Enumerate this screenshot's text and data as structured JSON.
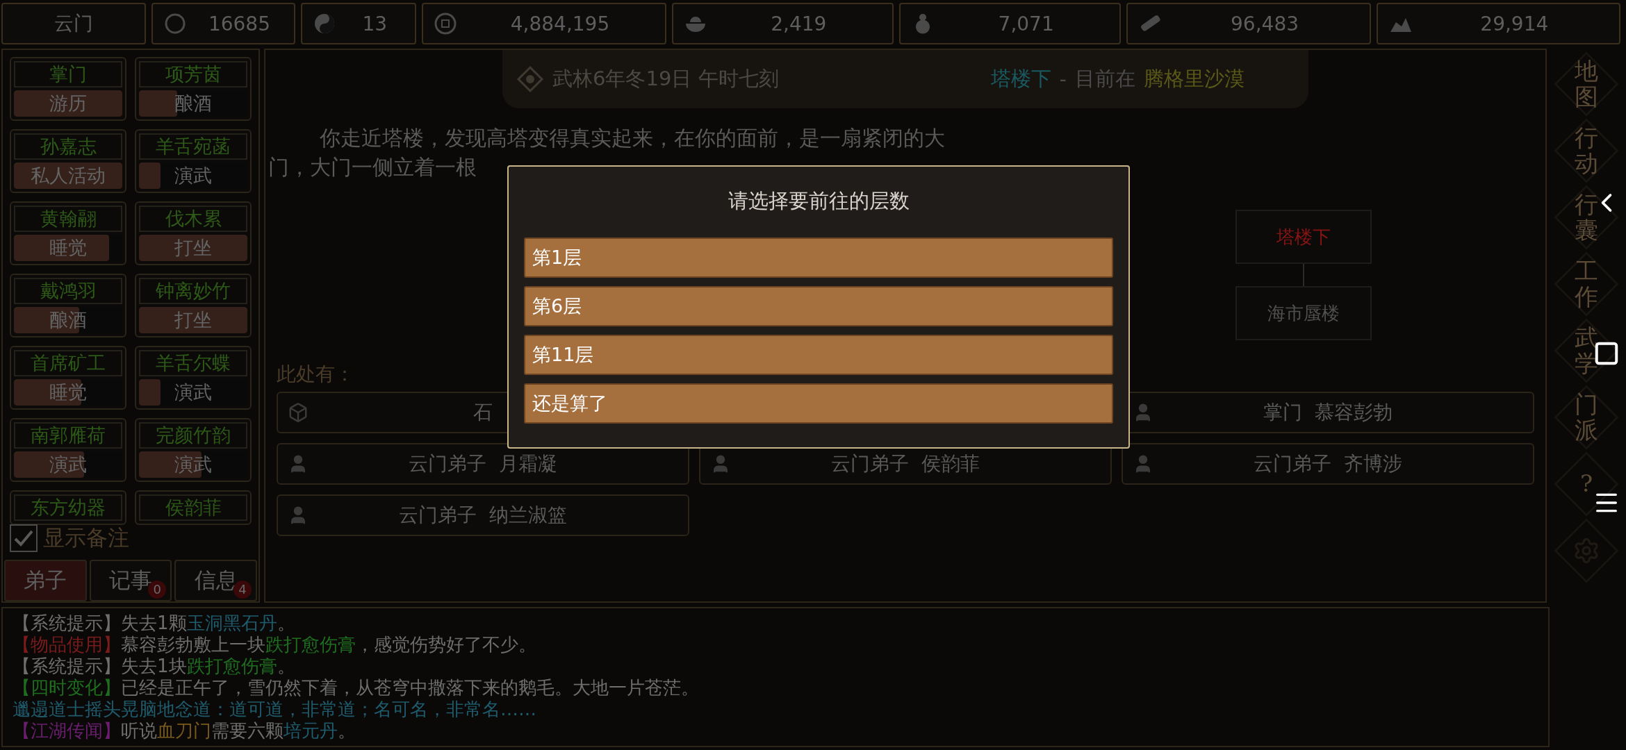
{
  "resources": [
    {
      "kind": "sect",
      "value": "云门"
    },
    {
      "kind": "fame",
      "value": "16685"
    },
    {
      "kind": "yinyang",
      "value": "13"
    },
    {
      "kind": "coin",
      "value": "4,884,195"
    },
    {
      "kind": "food",
      "value": "2,419"
    },
    {
      "kind": "gourd",
      "value": "7,071"
    },
    {
      "kind": "wood",
      "value": "96,483"
    },
    {
      "kind": "ore",
      "value": "29,914"
    }
  ],
  "disciples": [
    {
      "name": "掌门",
      "activity": "游历",
      "level": 1
    },
    {
      "name": "项芳茵",
      "activity": "酿酒",
      "level": 0.35
    },
    {
      "name": "孙嘉志",
      "activity": "私人活动",
      "level": 1
    },
    {
      "name": "羊舌宛菡",
      "activity": "演武",
      "level": 0.2
    },
    {
      "name": "黄翰翮",
      "activity": "睡觉",
      "level": 0.88
    },
    {
      "name": "伐木累",
      "activity": "打坐",
      "level": 1
    },
    {
      "name": "戴鸿羽",
      "activity": "酿酒",
      "level": 0.6
    },
    {
      "name": "钟离妙竹",
      "activity": "打坐",
      "level": 1
    },
    {
      "name": "首席矿工",
      "activity": "睡觉",
      "level": 0.62
    },
    {
      "name": "羊舌尔蝶",
      "activity": "演武",
      "level": 0.2
    },
    {
      "name": "南郭雁荷",
      "activity": "演武",
      "level": 0.65
    },
    {
      "name": "完颜竹韵",
      "activity": "演武",
      "level": 0.58
    },
    {
      "name": "东方幼器"
    },
    {
      "name": "侯韵菲"
    }
  ],
  "show_notes": {
    "label": "显示备注",
    "checked": true
  },
  "tabs": [
    {
      "label": "弟子",
      "selected": true
    },
    {
      "label": "记事",
      "selected": false,
      "badge": "0"
    },
    {
      "label": "信息",
      "selected": false,
      "badge": "4"
    }
  ],
  "header": {
    "date": "武林6年冬19日 午时七刻",
    "location": "塔楼下",
    "separator": " - ",
    "prefix": "目前在",
    "region": "腾格里沙漠"
  },
  "description": [
    "你走近塔楼，发现高塔变得真实起来，在你的面前，是一扇紧闭的大",
    "门，大门一侧立着一根"
  ],
  "map": [
    {
      "label": "塔楼下",
      "selected": true
    },
    {
      "label": "海市蜃楼",
      "selected": false
    }
  ],
  "here_label": "此处有：",
  "entities": [
    {
      "kind": "object",
      "label": "石"
    },
    {
      "kind": "person",
      "label": "掌门  慕容彭勃"
    },
    {
      "kind": "person",
      "label": "云门弟子  月霜凝"
    },
    {
      "kind": "person",
      "label": "云门弟子  侯韵菲"
    },
    {
      "kind": "person",
      "label": "云门弟子  齐博涉"
    },
    {
      "kind": "person",
      "label": "云门弟子  纳兰淑篮"
    }
  ],
  "dialog": {
    "title": "请选择要前往的层数",
    "options": [
      "第1层",
      "第6层",
      "第11层",
      "还是算了"
    ]
  },
  "log": [
    [
      {
        "text": "【系统提示】",
        "color": "#6e6e6e"
      },
      {
        "text": "失去1颗",
        "color": "#6e6e6e"
      },
      {
        "text": "玉洞黑石丹",
        "color": "#1f5c6e"
      },
      {
        "text": "。",
        "color": "#6e6e6e"
      }
    ],
    [
      {
        "text": "【物品使用】",
        "color": "#7a1c1c"
      },
      {
        "text": "慕容彭勃敷上一块",
        "color": "#6e6e6e"
      },
      {
        "text": "跌打愈伤膏",
        "color": "#1f6e1f"
      },
      {
        "text": "，感觉伤势好了不少。",
        "color": "#6e6e6e"
      }
    ],
    [
      {
        "text": "【系统提示】",
        "color": "#6e6e6e"
      },
      {
        "text": "失去1块",
        "color": "#6e6e6e"
      },
      {
        "text": "跌打愈伤膏",
        "color": "#1f6e1f"
      },
      {
        "text": "。",
        "color": "#6e6e6e"
      }
    ],
    [
      {
        "text": "【四时变化】",
        "color": "#1f6e1f"
      },
      {
        "text": "已经是正午了，雪仍然下着，从苍穹中撒落下来的鹅毛。大地一片苍茫。",
        "color": "#6e6e6e"
      }
    ],
    [
      {
        "text": "邋遢道士摇头晃脑地念道：道可道，非常道；名可名，非常名……",
        "color": "#1f5c6e"
      }
    ],
    [
      {
        "text": "【江湖传闻】",
        "color": "#6a1f6e"
      },
      {
        "text": "听说",
        "color": "#6e6e6e"
      },
      {
        "text": "血刀门",
        "color": "#7a5a1a"
      },
      {
        "text": "需要六颗",
        "color": "#6e6e6e"
      },
      {
        "text": "培元丹",
        "color": "#1f5c6e"
      },
      {
        "text": "。",
        "color": "#6e6e6e"
      }
    ]
  ],
  "side_menu": [
    {
      "kind": "text",
      "label": "地图"
    },
    {
      "kind": "text",
      "label": "行动"
    },
    {
      "kind": "text",
      "label": "行囊"
    },
    {
      "kind": "text",
      "label": "工作"
    },
    {
      "kind": "text",
      "label": "武学"
    },
    {
      "kind": "text",
      "label": "门派"
    },
    {
      "kind": "text",
      "label": "?"
    },
    {
      "kind": "gear"
    }
  ]
}
